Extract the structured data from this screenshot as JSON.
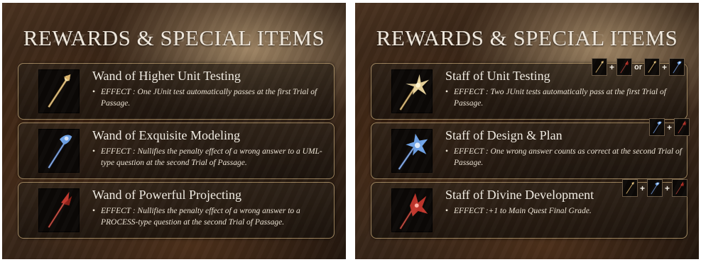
{
  "left_panel": {
    "title": "REWARDS & SPECIAL ITEMS",
    "items": [
      {
        "name": "Wand of Higher Unit Testing",
        "icon": "golden-wand-icon",
        "bullet": "•",
        "effect": "EFFECT : One JUnit test automatically passes at the first Trial of Passage."
      },
      {
        "name": "Wand of Exquisite Modeling",
        "icon": "blue-wand-icon",
        "bullet": "•",
        "effect": "EFFECT : Nullifies the penalty effect of a wrong answer to a UML-type question at the second Trial of Passage."
      },
      {
        "name": "Wand of Powerful Projecting",
        "icon": "red-wand-icon",
        "bullet": "•",
        "effect": "EFFECT : Nullifies the penalty effect of a wrong answer to a PROCESS-type question at the second Trial of Passage."
      }
    ]
  },
  "right_panel": {
    "title": "REWARDS & SPECIAL ITEMS",
    "items": [
      {
        "name": "Staff of Unit Testing",
        "icon": "golden-staff-icon",
        "bullet": "•",
        "effect": "EFFECT : Two JUnit tests automatically pass at the first Trial of Passage.",
        "recipe": {
          "plus1": "+",
          "or": "or",
          "plus2": "+"
        }
      },
      {
        "name": "Staff of Design & Plan",
        "icon": "blue-staff-icon",
        "bullet": "•",
        "effect": "EFFECT : One wrong answer counts as correct at the second Trial of Passage.",
        "recipe": {
          "plus1": "+"
        }
      },
      {
        "name": "Staff of Divine Development",
        "icon": "red-staff-icon",
        "bullet": "•",
        "effect": "EFFECT :+1 to Main Quest Final Grade.",
        "recipe": {
          "plus1": "+",
          "plus2": "+"
        }
      }
    ]
  },
  "colors": {
    "gold": "#d9b36a",
    "blue": "#6fa3e8",
    "red": "#c2362c",
    "card_border": "#c8aa78",
    "text": "#f4efe6"
  }
}
